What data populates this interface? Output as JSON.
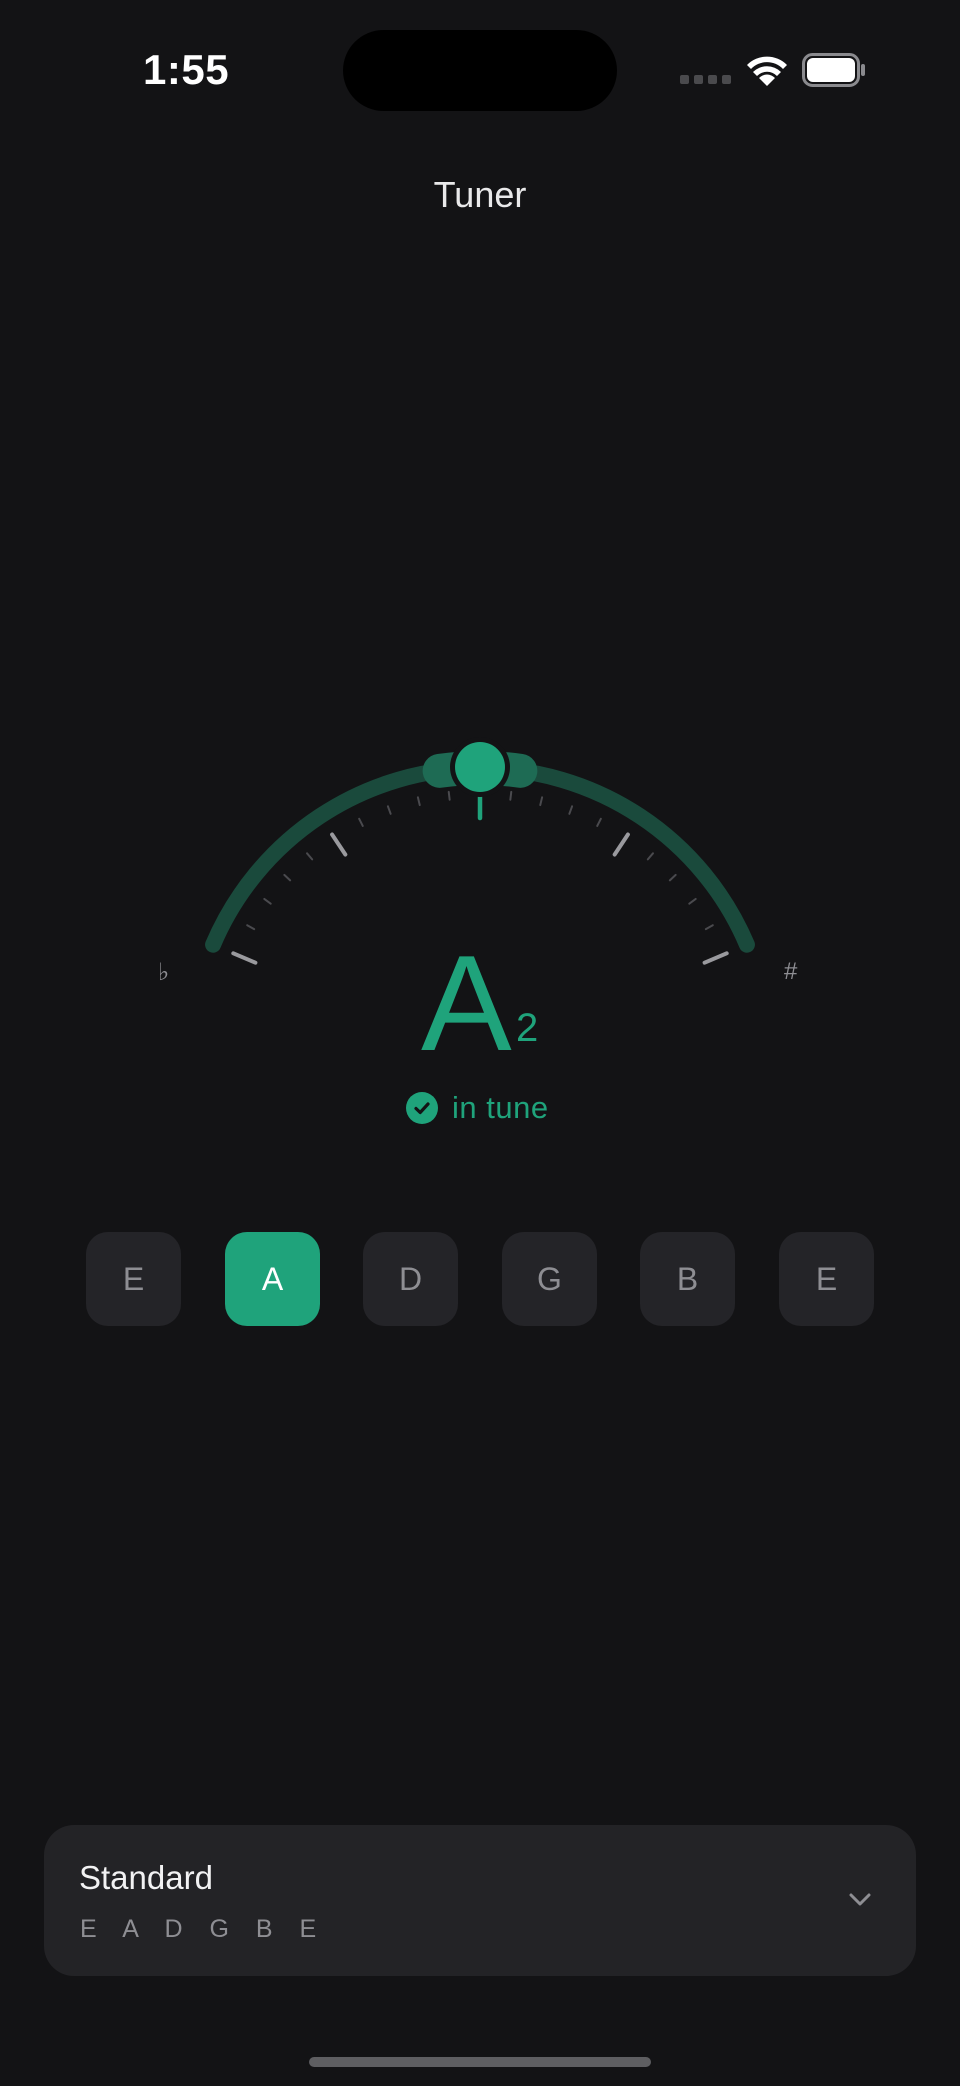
{
  "status_bar": {
    "time": "1:55"
  },
  "header": {
    "title": "Tuner"
  },
  "tuner": {
    "flat_symbol": "♭",
    "sharp_symbol": "#",
    "note": "A",
    "octave": "2",
    "status": "in tune",
    "accent_color": "#1fa37b",
    "cents_offset": 0
  },
  "strings": [
    {
      "label": "E",
      "selected": false
    },
    {
      "label": "A",
      "selected": true
    },
    {
      "label": "D",
      "selected": false
    },
    {
      "label": "G",
      "selected": false
    },
    {
      "label": "B",
      "selected": false
    },
    {
      "label": "E",
      "selected": false
    }
  ],
  "tuning": {
    "name": "Standard",
    "notes": "E A D G B E"
  },
  "icons": {
    "wifi": "wifi-icon",
    "battery": "battery-icon",
    "check": "checkmark-circle-icon",
    "chevron": "chevron-down-icon"
  }
}
